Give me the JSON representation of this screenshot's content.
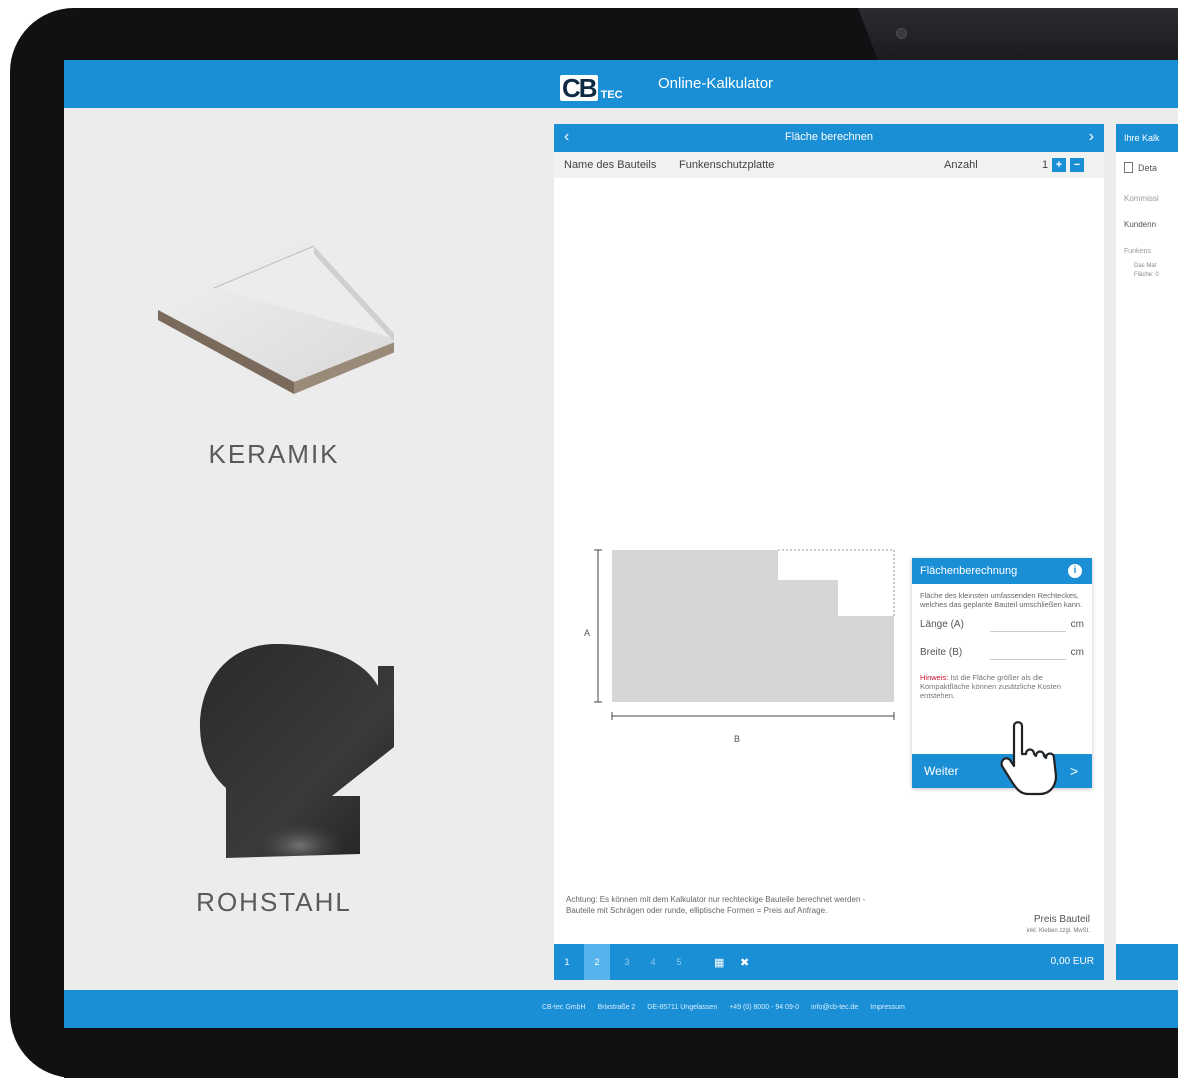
{
  "header": {
    "logo_main": "CB",
    "logo_sub": "TEC",
    "title": "Online-Kalkulator"
  },
  "products": [
    {
      "label": "KERAMIK"
    },
    {
      "label": "ROHSTAHL"
    }
  ],
  "calculator": {
    "title": "Fläche berechnen",
    "prev_icon": "chevron-left-icon",
    "next_icon": "chevron-right-icon",
    "part_name_label": "Name des Bauteils",
    "part_name_value": "Funkenschutzplatte",
    "quantity_label": "Anzahl",
    "quantity_value": "1",
    "plus_label": "+",
    "minus_label": "−",
    "drawing": {
      "dim_a": "A",
      "dim_b": "B"
    },
    "area_box": {
      "title": "Flächenberechnung",
      "info_label": "i",
      "description": "Fläche des kleinsten umfassenden Rechteckes, welches das geplante Bauteil umschließen kann.",
      "length_label": "Länge (A)",
      "width_label": "Breite (B)",
      "unit": "cm",
      "hint_prefix": "Hinweis:",
      "hint_text": "Ist die Fläche größer als die Kompaktfläche können zusätzliche Kosten entstehen.",
      "next_label": "Weiter",
      "next_chevron": ">"
    },
    "footnote": "Achtung: Es können mit dem Kalkulator nur rechteckige Bauteile berechnet werden - Bauteile mit Schrägen oder runde, elliptische Formen = Preis auf Anfrage.",
    "price_label": "Preis Bauteil",
    "price_sub": "inkl. Kleben zzgl. MwSt.",
    "steps": [
      "1",
      "2",
      "3",
      "4",
      "5"
    ],
    "active_step": "2",
    "total": "0,00 EUR"
  },
  "side_panel": {
    "title": "Ihre Kalk",
    "details_label": "Deta",
    "commission_label": "Kommissi",
    "customer_label": "Kundenn",
    "item_label": "Funkens",
    "detail_line1": "Das Mat",
    "detail_line2": "Fläche: 0"
  },
  "footer": {
    "items": [
      "CB-tec GmbH",
      "Brixstraße 2",
      "DE-85711 Ungelassen",
      "+49 (0) 8000 - 94 09-0",
      "info@cb-tec.de",
      "Impressum"
    ]
  },
  "colors": {
    "primary": "#1a8fd6",
    "active_step": "#56b4ec",
    "hint_red": "#c8102e"
  }
}
